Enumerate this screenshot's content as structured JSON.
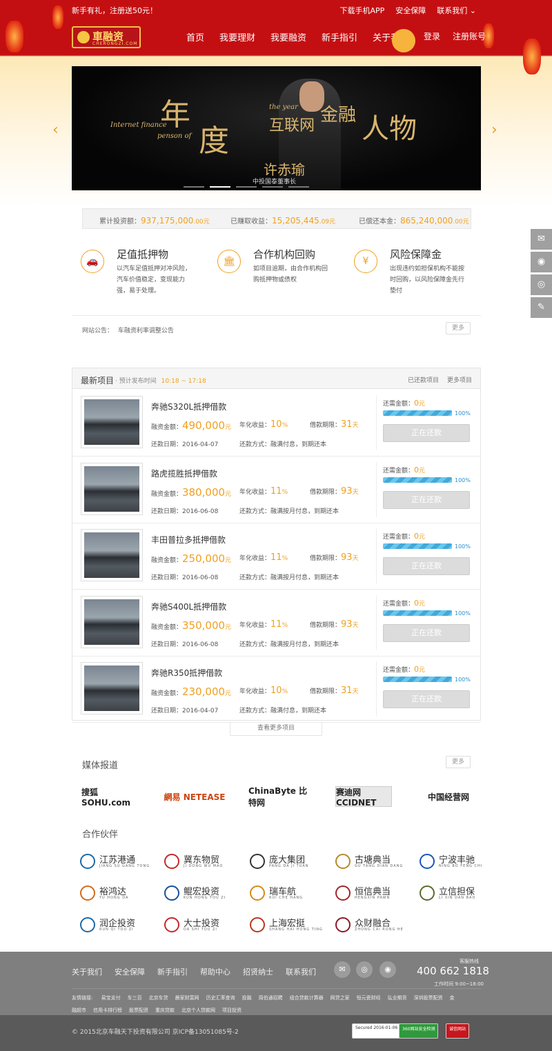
{
  "header": {
    "slogan": "新手有礼，注册送50元！",
    "top_links": [
      "下载手机APP",
      "安全保障",
      "联系我们 ⌄"
    ],
    "logo_name": "車融资",
    "logo_sub": "CHERONGZI.COM",
    "nav": [
      "首页",
      "我要理财",
      "我要融资",
      "新手指引",
      "关于我们"
    ],
    "auth": [
      "登录",
      "注册账号"
    ],
    "brand_color": "#c40f12",
    "accent_color": "#f0a020"
  },
  "banner": {
    "big1": "年",
    "big2": "度",
    "mid1": "互联网",
    "mid2": "金融",
    "big3": "人物",
    "en1": "Internet finance",
    "en2": "penson of",
    "en3": "the year",
    "name": "许赤瑜",
    "role": "中投国泰董事长",
    "prev": "‹",
    "next": "›"
  },
  "stats": [
    {
      "label": "累计投资额：",
      "value": "937,175,000",
      "unit": ".00元"
    },
    {
      "label": "已赚取收益：",
      "value": "15,205,445",
      "unit": ".09元"
    },
    {
      "label": "已偿还本金：",
      "value": "865,240,000",
      "unit": ".00元"
    }
  ],
  "features": [
    {
      "icon": "car-icon",
      "glyph": "🚗",
      "title": "足值抵押物",
      "desc": "以汽车足值抵押对冲风险，汽车价值稳定，变现能力强，易于处理。"
    },
    {
      "icon": "bank-icon",
      "glyph": "🏛",
      "title": "合作机构回购",
      "desc": "如项目逾期，由合作机构回购抵押物或债权"
    },
    {
      "icon": "money-bag-icon",
      "glyph": "¥",
      "title": "风险保障金",
      "desc": "出现违约如担保机构不能按时回购，以风险保障金先行垫付"
    }
  ],
  "notice": {
    "label": "网站公告：",
    "text": "车融资利率调整公告",
    "more": "更多"
  },
  "projects": {
    "title": "最新项目",
    "sub_label": "· 预计发布时间",
    "sub_time": "10:18 ~ 17:18",
    "links": [
      "已还款项目",
      "更多项目"
    ],
    "labels": {
      "amount": "融资金额：",
      "rate": "年化收益：",
      "term": "借款期限：",
      "date": "还款日期：",
      "method": "还款方式：",
      "need": "还需金额："
    },
    "items": [
      {
        "title": "奔驰S320L抵押借款",
        "amount": "490,000",
        "rate": "10",
        "term": "31",
        "date": "2016-04-07",
        "method": "融满付息，到期还本",
        "need": "0",
        "progress": 100,
        "status": "正在还款"
      },
      {
        "title": "路虎揽胜抵押借款",
        "amount": "380,000",
        "rate": "11",
        "term": "93",
        "date": "2016-06-08",
        "method": "融满按月付息，到期还本",
        "need": "0",
        "progress": 100,
        "status": "正在还款"
      },
      {
        "title": "丰田普拉多抵押借款",
        "amount": "250,000",
        "rate": "11",
        "term": "93",
        "date": "2016-06-08",
        "method": "融满按月付息，到期还本",
        "need": "0",
        "progress": 100,
        "status": "正在还款"
      },
      {
        "title": "奔驰S400L抵押借款",
        "amount": "350,000",
        "rate": "11",
        "term": "93",
        "date": "2016-06-08",
        "method": "融满按月付息，到期还本",
        "need": "0",
        "progress": 100,
        "status": "正在还款"
      },
      {
        "title": "奔驰R350抵押借款",
        "amount": "230,000",
        "rate": "10",
        "term": "31",
        "date": "2016-04-07",
        "method": "融满付息，到期还本",
        "need": "0",
        "progress": 100,
        "status": "正在还款"
      }
    ],
    "units": {
      "money": "元",
      "rate": "%",
      "term": "天",
      "pct": "%"
    },
    "load_more": "查看更多项目"
  },
  "media": {
    "title": "媒体报道",
    "more": "更多",
    "logos": [
      "搜狐 SOHU.com",
      "網易 NETEASE",
      "ChinaByte 比特网",
      "赛迪网 CCIDNET",
      "中国经营网"
    ]
  },
  "partners": {
    "title": "合作伙伴",
    "items": [
      {
        "name": "江苏港通",
        "en": "JIANG SU GANG TONG"
      },
      {
        "name": "冀东物贸",
        "en": "JI DONG WU MAO"
      },
      {
        "name": "庞大集团",
        "en": "PANG DA JI TUAN"
      },
      {
        "name": "古塘典当",
        "en": "GU TANG DIAN DANG"
      },
      {
        "name": "宁波丰驰",
        "en": "NING BO FENG CHI"
      },
      {
        "name": "裕鸿达",
        "en": "YU HONG DA"
      },
      {
        "name": "鲲宏投资",
        "en": "KUN HONG TOU ZI"
      },
      {
        "name": "瑞车航",
        "en": "RUI CHE HANG"
      },
      {
        "name": "恒信典当",
        "en": "HENGXIN PAWN"
      },
      {
        "name": "立信担保",
        "en": "LI XIN DAN BAO"
      },
      {
        "name": "润企投资",
        "en": "RUN QI TOU ZI"
      },
      {
        "name": "大士投资",
        "en": "DA SHI TOU ZI"
      },
      {
        "name": "上海宏挺",
        "en": "SHANG HAI HONG TING"
      },
      {
        "name": "众财融合",
        "en": "ZHONG CAI RONG HE"
      }
    ]
  },
  "side_tools": [
    "wechat-icon",
    "qq-icon",
    "weibo-icon",
    "edit-icon"
  ],
  "footer": {
    "links": [
      "关于我们",
      "安全保障",
      "新手指引",
      "帮助中心",
      "招贤纳士",
      "联系我们"
    ],
    "hotline_label": "客服热线",
    "hotline": "400 662 1818",
    "worktime": "工作时间 9:00~18:00",
    "friend_label": "友情链接:",
    "friend_links": [
      "易宝支付",
      "车三百",
      "北京车贷",
      "晨家财富网",
      "历史汇率查询",
      "投融",
      "周伯通招聘",
      "组合贷款计算器",
      "网贷之家",
      "恒元瓷财经",
      "弘业期货",
      "深圳股票配资",
      "金融超市",
      "信用卡排行榜",
      "股票配资",
      "重庆贷款",
      "北京个人贷款网",
      "项目投资"
    ],
    "copyright": "© 2015北京车融天下投资有限公司 京ICP备13051085号-2",
    "badges": [
      "Secured 2016-01-06",
      "360网站安全检测",
      "诚信网站"
    ]
  }
}
